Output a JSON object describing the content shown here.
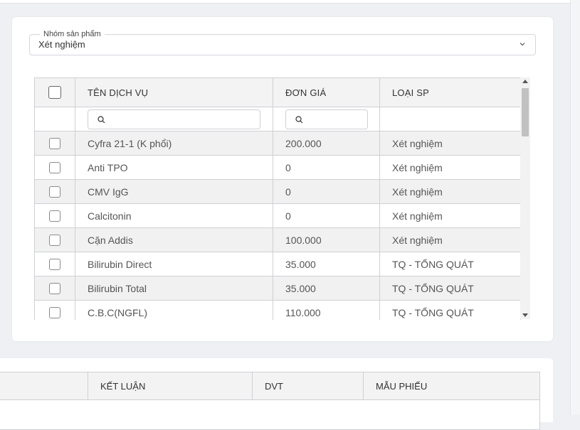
{
  "product_group": {
    "legend": "Nhóm sản phẩm",
    "value": "Xét nghiệm"
  },
  "services_table": {
    "columns": [
      "TÊN DỊCH VỤ",
      "ĐƠN GIÁ",
      "LOẠI SP"
    ],
    "rows": [
      {
        "name": "Cyfra 21-1 (K phổi)",
        "price": "200.000",
        "type": "Xét nghiệm"
      },
      {
        "name": "Anti TPO",
        "price": "0",
        "type": "Xét nghiệm"
      },
      {
        "name": "CMV IgG",
        "price": "0",
        "type": "Xét nghiệm"
      },
      {
        "name": "Calcitonin",
        "price": "0",
        "type": "Xét nghiệm"
      },
      {
        "name": "Cặn Addis",
        "price": "100.000",
        "type": "Xét nghiệm"
      },
      {
        "name": "Bilirubin Direct",
        "price": "35.000",
        "type": "TQ - TỔNG QUÁT"
      },
      {
        "name": "Bilirubin Total",
        "price": "35.000",
        "type": "TQ - TỔNG QUÁT"
      },
      {
        "name": "C.B.C(NGFL)",
        "price": "110.000",
        "type": "TQ - TỔNG QUÁT"
      }
    ]
  },
  "results_table": {
    "columns": [
      "",
      "KẾT LUẬN",
      "DVT",
      "MẪU PHIẾU"
    ]
  },
  "icons": {
    "select_arrow": "chevron-down-icon",
    "filter": "search-icon",
    "scroll_up": "arrow-up-icon",
    "scroll_down": "arrow-down-icon"
  }
}
